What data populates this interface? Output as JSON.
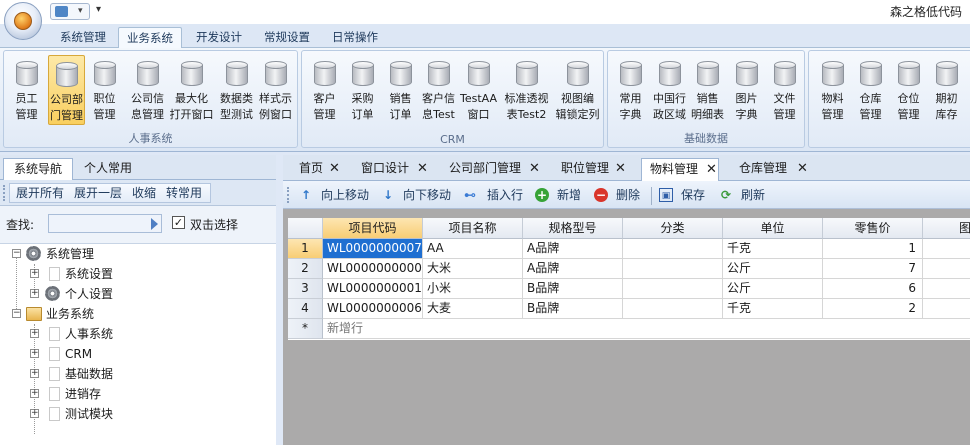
{
  "window": {
    "title": "森之格低代码"
  },
  "ribbon_tabs": [
    "系统管理",
    "业务系统",
    "开发设计",
    "常规设置",
    "日常操作"
  ],
  "ribbon_groups": [
    {
      "label": "人事系统",
      "buttons": [
        {
          "line1": "员工",
          "line2": "管理"
        },
        {
          "line1": "公司部",
          "line2": "门管理"
        },
        {
          "line1": "职位",
          "line2": "管理"
        },
        {
          "line1": "公司信",
          "line2": "息管理"
        },
        {
          "line1": "最大化",
          "line2": "打开窗口"
        },
        {
          "line1": "数据类",
          "line2": "型测试"
        },
        {
          "line1": "样式示",
          "line2": "例窗口"
        }
      ]
    },
    {
      "label": "CRM",
      "buttons": [
        {
          "line1": "客户",
          "line2": "管理"
        },
        {
          "line1": "采购",
          "line2": "订单"
        },
        {
          "line1": "销售",
          "line2": "订单"
        },
        {
          "line1": "客户信",
          "line2": "息Test"
        },
        {
          "line1": "TestAA",
          "line2": "窗口"
        },
        {
          "line1": "标准透视",
          "line2": "表Test2"
        },
        {
          "line1": "视图编",
          "line2": "辑锁定列"
        }
      ]
    },
    {
      "label": "基础数据",
      "buttons": [
        {
          "line1": "常用",
          "line2": "字典"
        },
        {
          "line1": "中国行",
          "line2": "政区域"
        },
        {
          "line1": "销售",
          "line2": "明细表"
        },
        {
          "line1": "图片",
          "line2": "字典"
        },
        {
          "line1": "文件",
          "line2": "管理"
        }
      ]
    },
    {
      "label": "",
      "buttons": [
        {
          "line1": "物料",
          "line2": "管理"
        },
        {
          "line1": "仓库",
          "line2": "管理"
        },
        {
          "line1": "仓位",
          "line2": "管理"
        },
        {
          "line1": "期初",
          "line2": "库存"
        }
      ]
    }
  ],
  "left_panel": {
    "tabs": [
      "系统导航",
      "个人常用"
    ],
    "toolbar": [
      "展开所有",
      "展开一层",
      "收缩",
      "转常用"
    ],
    "search_label": "查找:",
    "checkbox_label": "双击选择",
    "checkbox_checked": "✓",
    "tree": {
      "root1": "系统管理",
      "root1_children": [
        "系统设置",
        "个人设置"
      ],
      "root2": "业务系统",
      "root2_children": [
        "人事系统",
        "CRM",
        "基础数据",
        "进销存",
        "测试模块"
      ]
    }
  },
  "doc_tabs": [
    "首页",
    "窗口设计",
    "公司部门管理",
    "职位管理",
    "物料管理",
    "仓库管理"
  ],
  "doc_close": "✕",
  "grid_toolbar": [
    "向上移动",
    "向下移动",
    "插入行",
    "新增",
    "删除",
    "保存",
    "刷新"
  ],
  "grid": {
    "columns": [
      "项目代码",
      "项目名称",
      "规格型号",
      "分类",
      "单位",
      "零售价",
      "图"
    ],
    "rows": [
      {
        "num": "1",
        "code": "WL0000000007",
        "name": "AA",
        "spec": "A品牌",
        "cat": "",
        "unit": "千克",
        "price": "1"
      },
      {
        "num": "2",
        "code": "WL0000000000",
        "name": "大米",
        "spec": "A品牌",
        "cat": "",
        "unit": "公斤",
        "price": "7"
      },
      {
        "num": "3",
        "code": "WL0000000001",
        "name": "小米",
        "spec": "B品牌",
        "cat": "",
        "unit": "公斤",
        "price": "6"
      },
      {
        "num": "4",
        "code": "WL0000000006",
        "name": "大麦",
        "spec": "B品牌",
        "cat": "",
        "unit": "千克",
        "price": "2"
      }
    ],
    "new_row_marker": "*",
    "new_row_label": "新增行"
  }
}
